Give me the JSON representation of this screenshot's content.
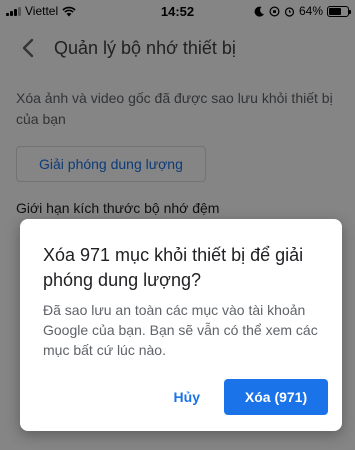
{
  "status_bar": {
    "carrier": "Viettel",
    "time": "14:52",
    "battery_percent_text": "64%",
    "battery_level": 0.64
  },
  "app_bar": {
    "title": "Quản lý bộ nhớ thiết bị"
  },
  "page": {
    "description": "Xóa ảnh và video gốc đã được sao lưu khỏi thiết bị của bạn",
    "free_up_label": "Giải phóng dung lượng",
    "section_title": "Giới hạn kích thước bộ nhớ đệm"
  },
  "dialog": {
    "title": "Xóa 971 mục khỏi thiết bị để giải phóng dung lượng?",
    "body": "Đã sao lưu an toàn các mục vào tài khoản Google của bạn. Bạn sẽ vẫn có thể xem các mục bất cứ lúc nào.",
    "cancel_label": "Hủy",
    "confirm_label": "Xóa (971)"
  },
  "colors": {
    "accent": "#1a73e8",
    "scrim": "rgba(0,0,0,0.48)"
  }
}
